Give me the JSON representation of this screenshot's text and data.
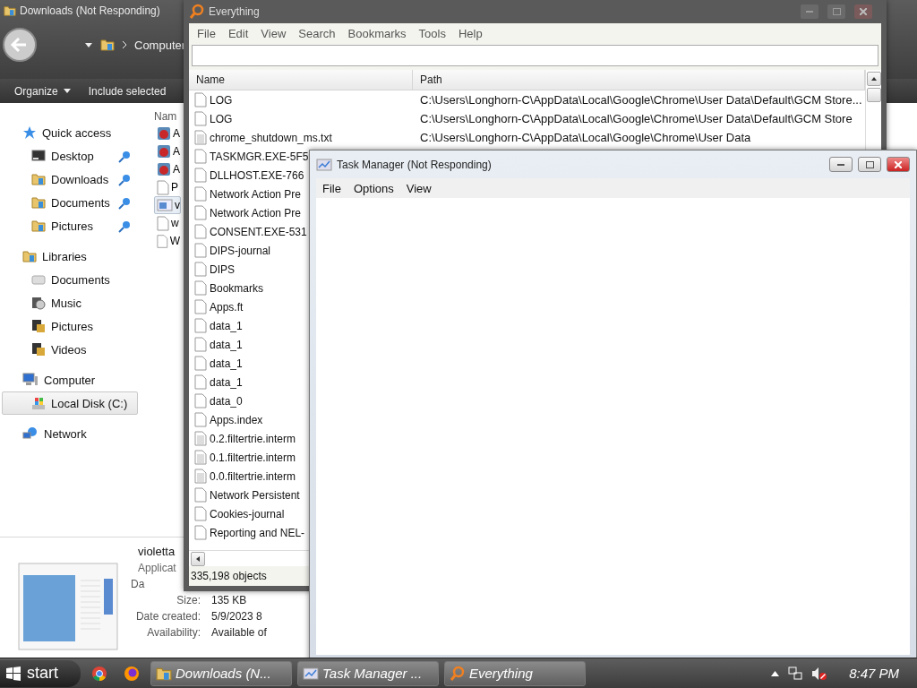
{
  "explorer": {
    "title": "Downloads (Not Responding)",
    "breadcrumb": "Computer",
    "toolbar": [
      {
        "label": "Organize",
        "dropdown": true
      },
      {
        "label": "Include selected",
        "dropdown": false
      }
    ],
    "sidebar": [
      {
        "label": "Quick access",
        "kind": "star",
        "selected": false,
        "children": [
          {
            "label": "Desktop",
            "kind": "desktop",
            "pinned": true,
            "selected": false
          },
          {
            "label": "Downloads",
            "kind": "folder",
            "pinned": true,
            "selected": false
          },
          {
            "label": "Documents",
            "kind": "folder",
            "pinned": true,
            "selected": false
          },
          {
            "label": "Pictures",
            "kind": "folder",
            "pinned": true,
            "selected": false
          }
        ]
      },
      {
        "label": "Libraries",
        "kind": "folder",
        "selected": false,
        "children": [
          {
            "label": "Documents",
            "kind": "library",
            "pinned": false,
            "selected": false
          },
          {
            "label": "Music",
            "kind": "music",
            "pinned": false,
            "selected": false
          },
          {
            "label": "Pictures",
            "kind": "film",
            "pinned": false,
            "selected": false
          },
          {
            "label": "Videos",
            "kind": "film",
            "pinned": false,
            "selected": false
          }
        ]
      },
      {
        "label": "Computer",
        "kind": "computer",
        "selected": false,
        "children": [
          {
            "label": "Local Disk (C:)",
            "kind": "drive",
            "pinned": false,
            "selected": true
          }
        ]
      },
      {
        "label": "Network",
        "kind": "network",
        "selected": false
      }
    ],
    "file_list": {
      "column": "Nam",
      "items": [
        {
          "label": "A",
          "kind": "app",
          "selected": false
        },
        {
          "label": "A",
          "kind": "app",
          "selected": false
        },
        {
          "label": "A",
          "kind": "app",
          "selected": false
        },
        {
          "label": "P",
          "kind": "file",
          "selected": false
        },
        {
          "label": "v",
          "kind": "image",
          "selected": true
        },
        {
          "label": "w",
          "kind": "file",
          "selected": false
        },
        {
          "label": "W",
          "kind": "file",
          "selected": false
        }
      ]
    },
    "details": {
      "name": "violetta",
      "type": "Applicat",
      "fields": [
        {
          "label": "Da"
        },
        {
          "label": "Size:",
          "value": "135 KB"
        },
        {
          "label": "Date created:",
          "value": "5/9/2023 8"
        },
        {
          "label": "Availability:",
          "value": "Available of"
        }
      ]
    }
  },
  "everything": {
    "title": "Everything",
    "menu": [
      "File",
      "Edit",
      "View",
      "Search",
      "Bookmarks",
      "Tools",
      "Help"
    ],
    "columns": [
      "Name",
      "Path"
    ],
    "rows": [
      {
        "name": "LOG",
        "kind": "file",
        "path": "C:\\Users\\Longhorn-C\\AppData\\Local\\Google\\Chrome\\User Data\\Default\\GCM Store..."
      },
      {
        "name": "LOG",
        "kind": "file",
        "path": "C:\\Users\\Longhorn-C\\AppData\\Local\\Google\\Chrome\\User Data\\Default\\GCM Store"
      },
      {
        "name": "chrome_shutdown_ms.txt",
        "kind": "text",
        "path": "C:\\Users\\Longhorn-C\\AppData\\Local\\Google\\Chrome\\User Data"
      },
      {
        "name": "TASKMGR.EXE-5F5",
        "kind": "file"
      },
      {
        "name": "DLLHOST.EXE-766",
        "kind": "file"
      },
      {
        "name": "Network Action Pre",
        "kind": "file"
      },
      {
        "name": "Network Action Pre",
        "kind": "file"
      },
      {
        "name": "CONSENT.EXE-531",
        "kind": "file"
      },
      {
        "name": "DIPS-journal",
        "kind": "file"
      },
      {
        "name": "DIPS",
        "kind": "file"
      },
      {
        "name": "Bookmarks",
        "kind": "file"
      },
      {
        "name": "Apps.ft",
        "kind": "file"
      },
      {
        "name": "data_1",
        "kind": "file"
      },
      {
        "name": "data_1",
        "kind": "file"
      },
      {
        "name": "data_1",
        "kind": "file"
      },
      {
        "name": "data_1",
        "kind": "file"
      },
      {
        "name": "data_0",
        "kind": "file"
      },
      {
        "name": "Apps.index",
        "kind": "file"
      },
      {
        "name": "0.2.filtertrie.interm",
        "kind": "text"
      },
      {
        "name": "0.1.filtertrie.interm",
        "kind": "text"
      },
      {
        "name": "0.0.filtertrie.interm",
        "kind": "text"
      },
      {
        "name": "Network Persistent",
        "kind": "file"
      },
      {
        "name": "Cookies-journal",
        "kind": "file"
      },
      {
        "name": "Reporting and NEL-",
        "kind": "file"
      }
    ],
    "status": "335,198 objects"
  },
  "task_manager": {
    "title": "Task Manager (Not Responding)",
    "menu": [
      "File",
      "Options",
      "View"
    ]
  },
  "taskbar": {
    "start": "start",
    "pinned": [
      {
        "kind": "chrome"
      },
      {
        "kind": "firefox"
      }
    ],
    "tasks": [
      {
        "label": "Downloads (N...",
        "kind": "folder"
      },
      {
        "label": "Task Manager ...",
        "kind": "taskmgr"
      },
      {
        "label": "Everything",
        "kind": "search"
      }
    ],
    "clock": "8:47 PM"
  }
}
